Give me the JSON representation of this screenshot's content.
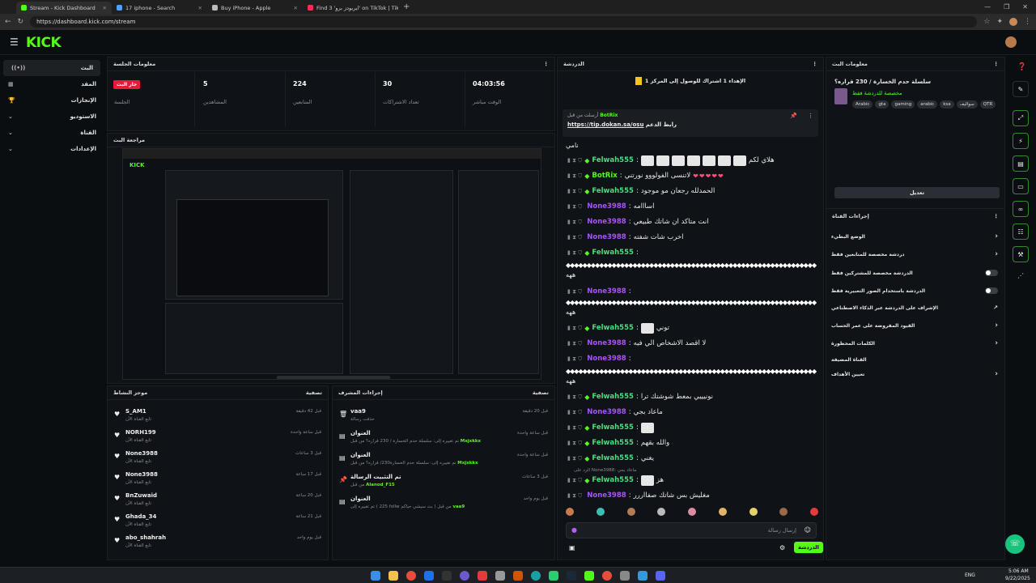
{
  "browser": {
    "tabs": [
      {
        "title": "Stream - Kick Dashboard",
        "active": true,
        "color": "#53fc18"
      },
      {
        "title": "17 iphone - Search",
        "active": false,
        "color": "#4aa3ff"
      },
      {
        "title": "Buy iPhone - Apple",
        "active": false,
        "color": "#bbbbbb"
      },
      {
        "title": "Find 3 'ايربودز برو' on TikTok | TikTok",
        "active": false,
        "color": "#ff2d55"
      }
    ],
    "url": "https://dashboard.kick.com/stream"
  },
  "header": {
    "logo": "KICK"
  },
  "sidebar": {
    "items": [
      {
        "label": "البث",
        "icon": "live-icon",
        "active": true
      },
      {
        "label": "المقد",
        "icon": "grid-icon",
        "active": false
      },
      {
        "label": "الإنجازات",
        "icon": "trophy-icon",
        "active": false
      },
      {
        "label": "الاستوديو",
        "icon": "chevron-down-icon",
        "active": false
      },
      {
        "label": "القناة",
        "icon": "chevron-down-icon",
        "active": false
      },
      {
        "label": "الإعدادات",
        "icon": "chevron-down-icon",
        "active": false
      }
    ]
  },
  "session": {
    "title": "معلومات الجلسة",
    "live_badge": "جار البث",
    "live_label": "الجلسة",
    "stats": [
      {
        "value": "5",
        "label": "المشاهدين"
      },
      {
        "value": "224",
        "label": "المتابعين"
      },
      {
        "value": "30",
        "label": "تعداد الاشتراكات"
      },
      {
        "value": "04:03:56",
        "label": "الوقت مباشر"
      }
    ]
  },
  "preview": {
    "title": "مراجعة البث"
  },
  "activity": {
    "title": "موجز النشاط",
    "filter": "تصفية",
    "items": [
      {
        "name": "S_AM1",
        "sub": "تابع القناة الآن",
        "time": "قبل 42 دقيقة"
      },
      {
        "name": "NORH199",
        "sub": "تابع القناة الآن",
        "time": "قبل ساعة واحدة"
      },
      {
        "name": "None3988",
        "sub": "تابع القناة الآن",
        "time": "قبل 3 ساعات"
      },
      {
        "name": "None3988",
        "sub": "تابع القناة الآن",
        "time": "قبل 17 ساعة"
      },
      {
        "name": "BnZuwaid",
        "sub": "تابع القناة الآن",
        "time": "قبل 20 ساعة"
      },
      {
        "name": "Ghada_34",
        "sub": "تابع القناة الآن",
        "time": "قبل 21 ساعة"
      },
      {
        "name": "abo_shahrah",
        "sub": "تابع القناة الآن",
        "time": "قبل يوم واحد"
      }
    ]
  },
  "modactions": {
    "title": "إجراءات المشرف",
    "filter": "تصفية",
    "items": [
      {
        "title": "vaa9",
        "sub": "حذفت رسالة",
        "time": "قبل 20 دقيقة",
        "user": ""
      },
      {
        "title": "العنوان",
        "sub": "تم تغييره إلى: سلسلة حدم الخسارة / 230 قراره؟ من قبل",
        "time": "قبل ساعة واحدة",
        "user": "Mxjxkkx"
      },
      {
        "title": "العنوان",
        "sub": "تم تغييره إلى: سلسلة حدم الخسارة230/ قراره؟ من قبل",
        "time": "قبل ساعة واحدة",
        "user": "Mxjxkkx"
      },
      {
        "title": "تم التثبيت الرسالة",
        "sub": "من قبل",
        "time": "قبل 3 ساعات",
        "user": "Alanod_F15"
      },
      {
        "title": "العنوان",
        "sub": "تم تغييره إلى ( 225 follw بث سيشي حياكم ) من قبل",
        "time": "قبل يوم واحد",
        "user": "vaa9"
      }
    ]
  },
  "chat": {
    "title": "الدردشة",
    "goal": "الإهداء 1 اشتراك للوصول إلى المركز 1",
    "pinned_by": "أرسلت من قبل",
    "pinned_user": "BotRix",
    "pinned_label": "رابط الدعم",
    "pinned_link": "https://tip.dokan.sa/osu",
    "first_line": "نامي",
    "messages": [
      {
        "user": "Felwah555",
        "cls": "u-f",
        "text": "هلاي لكم",
        "emotes": 7,
        "hearts": ""
      },
      {
        "user": "BotRix",
        "cls": "u-b",
        "text": "لاتنسى الفولووو نورتني",
        "emotes": 0,
        "hearts": "❤❤❤❤❤"
      },
      {
        "user": "Felwah555",
        "cls": "u-f",
        "text": "الحمدلله رجعان مو موجود",
        "emotes": 0,
        "hearts": ""
      },
      {
        "user": "None3988",
        "cls": "u-n",
        "text": "اسااامه",
        "emotes": 0,
        "hearts": ""
      },
      {
        "user": "None3988",
        "cls": "u-n",
        "text": "انت متاكد ان شاتك طبيعي",
        "emotes": 0,
        "hearts": ""
      },
      {
        "user": "None3988",
        "cls": "u-n",
        "text": "اخرب شات شفته",
        "emotes": 0,
        "hearts": ""
      },
      {
        "user": "Felwah555",
        "cls": "u-f",
        "text": "",
        "emotes": 0,
        "hearts": ""
      }
    ],
    "messages2": [
      {
        "user": "None3988",
        "cls": "u-n",
        "text": "",
        "emotes": 0
      },
      {
        "user": "Felwah555",
        "cls": "u-f",
        "text": "توني",
        "emotes": 1
      },
      {
        "user": "None3988",
        "cls": "u-n",
        "text": "لا اقصد الاشخاص الي فيه",
        "emotes": 0
      },
      {
        "user": "None3988",
        "cls": "u-n",
        "text": "",
        "emotes": 0
      }
    ],
    "messages3": [
      {
        "user": "Felwah555",
        "cls": "u-f",
        "text": "نونيييي بمعط شوشتك ترا",
        "emotes": 0
      },
      {
        "user": "None3988",
        "cls": "u-n",
        "text": "ماعاد بجي",
        "emotes": 0
      },
      {
        "user": "Felwah555",
        "cls": "u-f",
        "text": "",
        "emotes": 1
      },
      {
        "user": "Felwah555",
        "cls": "u-f",
        "text": "والله بقهم",
        "emotes": 0
      },
      {
        "user": "Felwah555",
        "cls": "u-f",
        "text": "يغني",
        "emotes": 0
      }
    ],
    "reply_hint": "الرد على None3988: ماعاد بجي",
    "messages4": [
      {
        "user": "Felwah555",
        "cls": "u-f",
        "text": "هز",
        "emotes": 1
      },
      {
        "user": "None3988",
        "cls": "u-n",
        "text": "مغليش بس شاتك صفااررر",
        "emotes": 0
      }
    ],
    "dash_suffix": "ههه",
    "input_placeholder": "إرسال رسالة",
    "send_label": "الدردشة"
  },
  "streaminfo": {
    "title": "معلومات البث",
    "stream_title": "سلسلة حدم الخسارة / 230 قراره؟",
    "category": "مخصصة للدردشة فقط",
    "tags": [
      "Arabic",
      "gta",
      "gaming",
      "arabic",
      "ksa",
      "سواليف",
      "QTR"
    ],
    "edit_label": "تعديل"
  },
  "channelactions": {
    "title": "إجراءات القناة",
    "rows": [
      {
        "label": "الوضع البطيء",
        "control": "chevron"
      },
      {
        "label": "دردشة مخصصة للمتابعين فقط",
        "control": "chevron"
      },
      {
        "label": "الدردشة مخصصة للمشتركين فقط",
        "control": "toggle"
      },
      {
        "label": "الدردشة باستخدام الصور التعبيرية فقط",
        "control": "toggle"
      },
      {
        "label": "الإشراف على الدردشة عبر الذكاء الاصطناعي",
        "control": "external"
      },
      {
        "label": "القيود المفروضة على عمر الحساب",
        "control": "chevron"
      },
      {
        "label": "الكلمات المحظورة",
        "control": "chevron"
      },
      {
        "label": "القناة المضيفة",
        "control": "none"
      },
      {
        "label": "تعيين الأهداف",
        "control": "chevron"
      }
    ]
  },
  "taskbar": {
    "lang": "ENG",
    "time": "5:06 AM",
    "date": "9/22/2025"
  }
}
